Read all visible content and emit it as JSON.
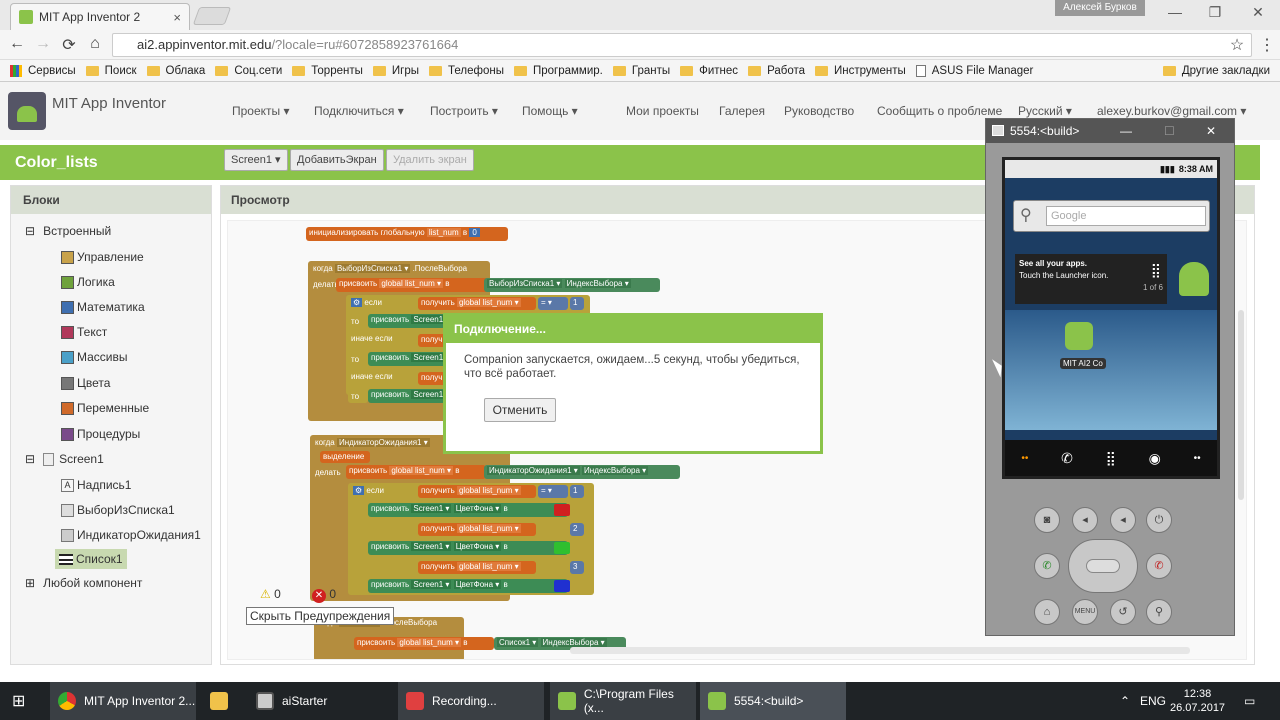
{
  "browser": {
    "tab_title": "MIT App Inventor 2",
    "tab_close": "×",
    "profile_name": "Алексей Бурков",
    "url_host": "ai2.appinventor.mit.edu",
    "url_rest": "/?locale=ru#6072858923761664",
    "back": "←",
    "forward": "→",
    "reload": "⟳",
    "home": "⌂",
    "star": "☆",
    "menu": "⋮",
    "minimize": "—",
    "maximize": "❐",
    "close": "✕"
  },
  "bookmarks": [
    "Сервисы",
    "Поиск",
    "Облака",
    "Соц.сети",
    "Торренты",
    "Игры",
    "Телефоны",
    "Программир.",
    "Гранты",
    "Фитнес",
    "Работа",
    "Инструменты",
    "ASUS File Manager",
    "Другие закладки"
  ],
  "app": {
    "title": "MIT App Inventor",
    "menu": [
      "Проекты ▾",
      "Подключиться ▾",
      "Построить ▾",
      "Помощь ▾",
      "Мои проекты",
      "Галерея",
      "Руководство",
      "Сообщить о проблеме",
      "Русский ▾",
      "alexey.burkov@gmail.com ▾"
    ],
    "project_name": "Color_lists",
    "screen_select": "Screen1 ▾",
    "add_screen": "ДобавитьЭкран",
    "remove_screen": "Удалить экран"
  },
  "blocks_panel": {
    "header": "Блоки",
    "builtin": "Встроенный",
    "categories": [
      {
        "label": "Управление",
        "color": "#c8a24a"
      },
      {
        "label": "Логика",
        "color": "#6fa23c"
      },
      {
        "label": "Математика",
        "color": "#3f6fb0"
      },
      {
        "label": "Текст",
        "color": "#b0385a"
      },
      {
        "label": "Массивы",
        "color": "#4aa0c8"
      },
      {
        "label": "Цвета",
        "color": "#777777"
      },
      {
        "label": "Переменные",
        "color": "#d06a2a"
      },
      {
        "label": "Процедуры",
        "color": "#7a4a8a"
      }
    ],
    "screen": "Screen1",
    "components": [
      "Надпись1",
      "ВыборИзСписка1",
      "ИндикаторОжидания1",
      "Список1"
    ],
    "any_component": "Любой компонент"
  },
  "viewer": {
    "header": "Просмотр",
    "warnings_count": "0",
    "errors_count": "0",
    "hide_warnings": "Скрыть Предупреждения",
    "blocks": {
      "init_global": "инициализировать глобальную",
      "var_name": "list_num",
      "to": "в",
      "init_value": "0",
      "when1": "когда",
      "event1": "ВыборИзСписка1 ▾",
      "after_pick": ".ПослеВыбора",
      "do": "делать",
      "set": "присвоить",
      "global_list_num": "global list_num ▾",
      "picker_ref": "ВыборИзСписка1 ▾",
      "selection_index": "ИндексВыбора ▾",
      "if": "если",
      "get": "получить",
      "eq": "= ▾",
      "n1": "1",
      "then": "то",
      "screen1": "Screen1 ▾",
      "else_if": "иначе если",
      "event2": "ИндикаторОжидания1 ▾",
      "selection": "выделение",
      "indicator_ref": "ИндикаторОжидания1 ▾",
      "bg_color": "ЦветФона ▾",
      "n2": "2",
      "n3": "3",
      "event3": "Список1 ▾",
      "list_ref": "Список1 ▾"
    }
  },
  "dialog": {
    "title": "Подключение...",
    "message": "Companion запускается, ожидаем...5 секунд, чтобы убедиться, что всё работает.",
    "cancel": "Отменить"
  },
  "emulator": {
    "title": "5554:<build>",
    "time": "8:38 AM",
    "search_placeholder": "Google",
    "tip_line1": "See all your apps.",
    "tip_line2": "Touch the Launcher icon.",
    "tip_page": "1 of 6",
    "app_label": "MIT AI2 Co",
    "min": "—",
    "max": "☐",
    "close": "✕"
  },
  "taskbar": {
    "tasks": [
      "MIT App Inventor 2...",
      "aiStarter",
      "Recording...",
      "C:\\Program Files (x...",
      "5554:<build>"
    ],
    "lang": "ENG",
    "time": "12:38",
    "date": "26.07.2017"
  },
  "colors": {
    "accent": "#8bc34a",
    "red": "#d02020",
    "green": "#2fbf2f",
    "blue": "#2030d0"
  }
}
